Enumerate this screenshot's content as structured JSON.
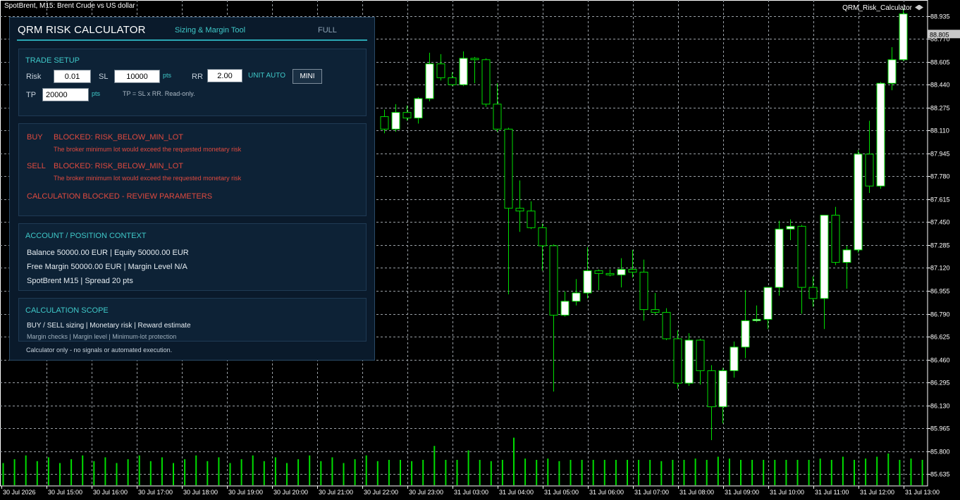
{
  "window": {
    "chart_title": "SpotBrent, M15:  Brent Crude vs US dollar",
    "indicator_label": "QRM_Risk_Calculator",
    "indicator_icon": "graduation-cap-icon"
  },
  "chart": {
    "symbol": "SpotBrent",
    "timeframe": "M15",
    "current_price": "88.805",
    "price_ticks": [
      "88.935",
      "88.770",
      "88.605",
      "88.440",
      "88.275",
      "88.110",
      "87.945",
      "87.780",
      "87.615",
      "87.450",
      "87.285",
      "87.120",
      "86.955",
      "86.790",
      "86.625",
      "86.460",
      "86.295",
      "86.130",
      "85.965",
      "85.800",
      "85.635"
    ],
    "time_ticks": [
      "30 Jul 2026",
      "30 Jul 15:00",
      "30 Jul 16:00",
      "30 Jul 17:00",
      "30 Jul 18:00",
      "30 Jul 19:00",
      "30 Jul 20:00",
      "30 Jul 21:00",
      "30 Jul 22:00",
      "30 Jul 23:00",
      "31 Jul 03:00",
      "31 Jul 04:00",
      "31 Jul 05:00",
      "31 Jul 06:00",
      "31 Jul 07:00",
      "31 Jul 08:00",
      "31 Jul 09:00",
      "31 Jul 10:00",
      "31 Jul 11:00",
      "31 Jul 12:00",
      "31 Jul 13:00"
    ],
    "colors": {
      "background": "#000000",
      "grid": "#9aa0a6",
      "bull_body": "#ffffff",
      "bear_body": "#000000",
      "wick": "#00dd00",
      "volume": "#00dd00",
      "text": "#ffffff"
    },
    "candles": [
      {
        "o": 88.21,
        "h": 88.26,
        "l": 88.09,
        "c": 88.12
      },
      {
        "o": 88.12,
        "h": 88.3,
        "l": 88.1,
        "c": 88.24
      },
      {
        "o": 88.24,
        "h": 88.29,
        "l": 88.18,
        "c": 88.2
      },
      {
        "o": 88.2,
        "h": 88.35,
        "l": 88.16,
        "c": 88.34
      },
      {
        "o": 88.34,
        "h": 88.67,
        "l": 88.32,
        "c": 88.59
      },
      {
        "o": 88.59,
        "h": 88.66,
        "l": 88.47,
        "c": 88.49
      },
      {
        "o": 88.49,
        "h": 88.53,
        "l": 88.43,
        "c": 88.44
      },
      {
        "o": 88.44,
        "h": 88.68,
        "l": 88.43,
        "c": 88.63
      },
      {
        "o": 88.63,
        "h": 88.64,
        "l": 88.45,
        "c": 88.62
      },
      {
        "o": 88.62,
        "h": 88.63,
        "l": 88.28,
        "c": 88.3
      },
      {
        "o": 88.3,
        "h": 88.45,
        "l": 88.1,
        "c": 88.12
      },
      {
        "o": 88.12,
        "h": 88.13,
        "l": 86.93,
        "c": 87.55
      },
      {
        "o": 87.55,
        "h": 87.75,
        "l": 87.38,
        "c": 87.53
      },
      {
        "o": 87.53,
        "h": 87.6,
        "l": 87.4,
        "c": 87.41
      },
      {
        "o": 87.41,
        "h": 87.44,
        "l": 87.1,
        "c": 87.28
      },
      {
        "o": 87.28,
        "h": 87.29,
        "l": 86.23,
        "c": 86.78
      },
      {
        "o": 86.78,
        "h": 86.95,
        "l": 86.77,
        "c": 86.88
      },
      {
        "o": 86.88,
        "h": 87.04,
        "l": 86.85,
        "c": 86.94
      },
      {
        "o": 86.94,
        "h": 87.27,
        "l": 86.9,
        "c": 87.1
      },
      {
        "o": 87.1,
        "h": 87.11,
        "l": 86.96,
        "c": 87.08
      },
      {
        "o": 87.08,
        "h": 87.11,
        "l": 87.06,
        "c": 87.07
      },
      {
        "o": 87.07,
        "h": 87.19,
        "l": 86.98,
        "c": 87.11
      },
      {
        "o": 87.11,
        "h": 87.25,
        "l": 87.05,
        "c": 87.09
      },
      {
        "o": 87.09,
        "h": 87.18,
        "l": 86.74,
        "c": 86.82
      },
      {
        "o": 86.82,
        "h": 86.94,
        "l": 86.78,
        "c": 86.8
      },
      {
        "o": 86.8,
        "h": 86.83,
        "l": 86.6,
        "c": 86.61
      },
      {
        "o": 86.61,
        "h": 86.67,
        "l": 86.25,
        "c": 86.29
      },
      {
        "o": 86.29,
        "h": 86.65,
        "l": 86.27,
        "c": 86.6
      },
      {
        "o": 86.6,
        "h": 86.61,
        "l": 86.28,
        "c": 86.38
      },
      {
        "o": 86.38,
        "h": 86.42,
        "l": 85.88,
        "c": 86.12
      },
      {
        "o": 86.12,
        "h": 86.4,
        "l": 86.0,
        "c": 86.38
      },
      {
        "o": 86.38,
        "h": 86.59,
        "l": 86.33,
        "c": 86.55
      },
      {
        "o": 86.55,
        "h": 86.96,
        "l": 86.47,
        "c": 86.74
      },
      {
        "o": 86.74,
        "h": 86.85,
        "l": 86.73,
        "c": 86.75
      },
      {
        "o": 86.75,
        "h": 86.98,
        "l": 86.68,
        "c": 86.98
      },
      {
        "o": 86.98,
        "h": 87.46,
        "l": 86.92,
        "c": 87.4
      },
      {
        "o": 87.4,
        "h": 87.47,
        "l": 87.32,
        "c": 87.42
      },
      {
        "o": 87.42,
        "h": 87.43,
        "l": 86.79,
        "c": 86.98
      },
      {
        "o": 86.98,
        "h": 87.06,
        "l": 86.84,
        "c": 86.9
      },
      {
        "o": 86.9,
        "h": 87.5,
        "l": 86.68,
        "c": 87.5
      },
      {
        "o": 87.5,
        "h": 87.56,
        "l": 87.14,
        "c": 87.16
      },
      {
        "o": 87.16,
        "h": 87.28,
        "l": 86.97,
        "c": 87.25
      },
      {
        "o": 87.25,
        "h": 87.97,
        "l": 87.23,
        "c": 87.94
      },
      {
        "o": 87.94,
        "h": 88.18,
        "l": 87.66,
        "c": 87.71
      },
      {
        "o": 87.71,
        "h": 88.46,
        "l": 87.69,
        "c": 88.45
      },
      {
        "o": 88.45,
        "h": 88.71,
        "l": 88.4,
        "c": 88.62
      },
      {
        "o": 88.62,
        "h": 88.99,
        "l": 88.61,
        "c": 88.95
      }
    ],
    "volumes": [
      0.4,
      0.4,
      0.38,
      0.4,
      0.62,
      0.4,
      0.4,
      0.55,
      0.4,
      0.38,
      0.4,
      0.75,
      0.42,
      0.4,
      0.42,
      0.38,
      0.4,
      0.4,
      0.4,
      0.4,
      0.4,
      0.4,
      0.4,
      0.4,
      0.38,
      0.4,
      0.4,
      0.42,
      0.4,
      0.45,
      0.42,
      0.4,
      0.4,
      0.4,
      0.4,
      0.4,
      0.4,
      0.4,
      0.42,
      0.4,
      0.45,
      0.4,
      0.42,
      0.45,
      0.5,
      0.4,
      0.42
    ]
  },
  "panel": {
    "title": "QRM RISK CALCULATOR",
    "subtitle": "Sizing & Margin Tool",
    "mode_tab": "FULL",
    "trade_setup": {
      "title": "TRADE SETUP",
      "risk_label": "Risk",
      "risk_value": "0.01",
      "sl_label": "SL",
      "sl_value": "10000",
      "sl_unit": "pts",
      "rr_label": "RR",
      "rr_value": "2.00",
      "unit_mode": "UNIT AUTO",
      "mini_button": "MINI",
      "tp_label": "TP",
      "tp_value": "20000",
      "tp_unit": "pts",
      "tp_note": "TP = SL x RR. Read-only."
    },
    "results": {
      "buy_label": "BUY",
      "buy_status": "BLOCKED: RISK_BELOW_MIN_LOT",
      "buy_detail": "The broker minimum lot would exceed the requested monetary risk",
      "sell_label": "SELL",
      "sell_status": "BLOCKED: RISK_BELOW_MIN_LOT",
      "sell_detail": "The broker minimum lot would exceed the requested monetary risk",
      "summary": "CALCULATION BLOCKED - REVIEW PARAMETERS"
    },
    "account": {
      "title": "ACCOUNT / POSITION CONTEXT",
      "line1": "Balance 50000.00 EUR | Equity 50000.00 EUR",
      "line2": "Free Margin 50000.00 EUR | Margin Level N/A",
      "line3": "SpotBrent M15 | Spread 20 pts"
    },
    "scope": {
      "title": "CALCULATION SCOPE",
      "line1": "BUY / SELL sizing  |  Monetary risk  |  Reward estimate",
      "line2": "Margin checks  |  Margin level  |  Minimum-lot protection",
      "footer": "Calculator only - no signals or automated execution."
    }
  }
}
